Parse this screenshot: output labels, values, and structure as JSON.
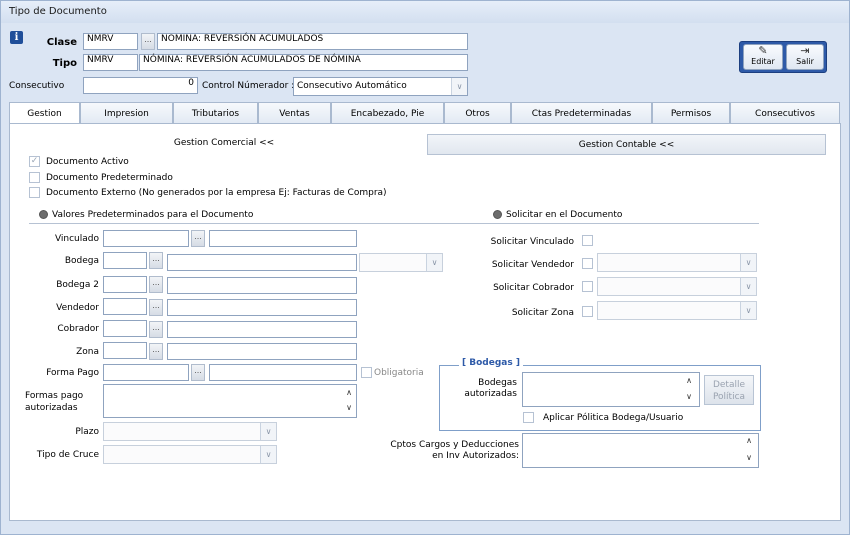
{
  "window": {
    "title": "Tipo de Documento"
  },
  "header": {
    "clase_label": "Clase",
    "clase_code": "NMRV",
    "clase_desc": "NOMINA: REVERSIÓN ACUMULADOS",
    "tipo_label": "Tipo",
    "tipo_code": "NMRV",
    "tipo_desc": "NÓMINA: REVERSIÓN ACUMULADOS DE NÓMINA",
    "consecutivo_label": "Consecutivo",
    "consecutivo_value": "0",
    "control_label": "Control Númerador :",
    "control_value": "Consecutivo Automático",
    "dots": "..."
  },
  "toolbar": {
    "editar": "Editar",
    "salir": "Salir"
  },
  "tabs": [
    "Gestion",
    "Impresion",
    "Tributarios",
    "Ventas",
    "Encabezado, Pie",
    "Otros",
    "Ctas Predeterminadas",
    "Permisos",
    "Consecutivos"
  ],
  "subtabs": {
    "comercial": "Gestion Comercial <<",
    "contable": "Gestion Contable <<"
  },
  "checks": {
    "activo": "Documento Activo",
    "predeterminado": "Documento Predeterminado",
    "externo": "Documento Externo (No generados por la empresa  Ej: Facturas de Compra)"
  },
  "sections": {
    "valores": "Valores Predeterminados para el Documento",
    "solicitar": "Solicitar en el Documento"
  },
  "fields": {
    "vinculado": "Vinculado",
    "bodega": "Bodega",
    "bodega2": "Bodega 2",
    "vendedor": "Vendedor",
    "cobrador": "Cobrador",
    "zona": "Zona",
    "forma_pago": "Forma Pago",
    "obligatoria": "Obligatoria",
    "formas_pago_1": "Formas pago",
    "formas_pago_2": "autorizadas",
    "plazo": "Plazo",
    "tipo_cruce": "Tipo de Cruce"
  },
  "solicitar": {
    "vinculado": "Solicitar Vinculado",
    "vendedor": "Solicitar Vendedor",
    "cobrador": "Solicitar Cobrador",
    "zona": "Solicitar Zona"
  },
  "bodegas": {
    "title": "[ Bodegas ]",
    "label_1": "Bodegas",
    "label_2": "autorizadas",
    "detalle_1": "Detalle",
    "detalle_2": "Política",
    "aplicar": "Aplicar Pólitica Bodega/Usuario"
  },
  "cptos": {
    "label_1": "Cptos Cargos y Deducciones",
    "label_2": "en Inv Autorizados:"
  },
  "colors": {
    "accent": "#2e5aa8",
    "background": "#dbe5f3"
  }
}
